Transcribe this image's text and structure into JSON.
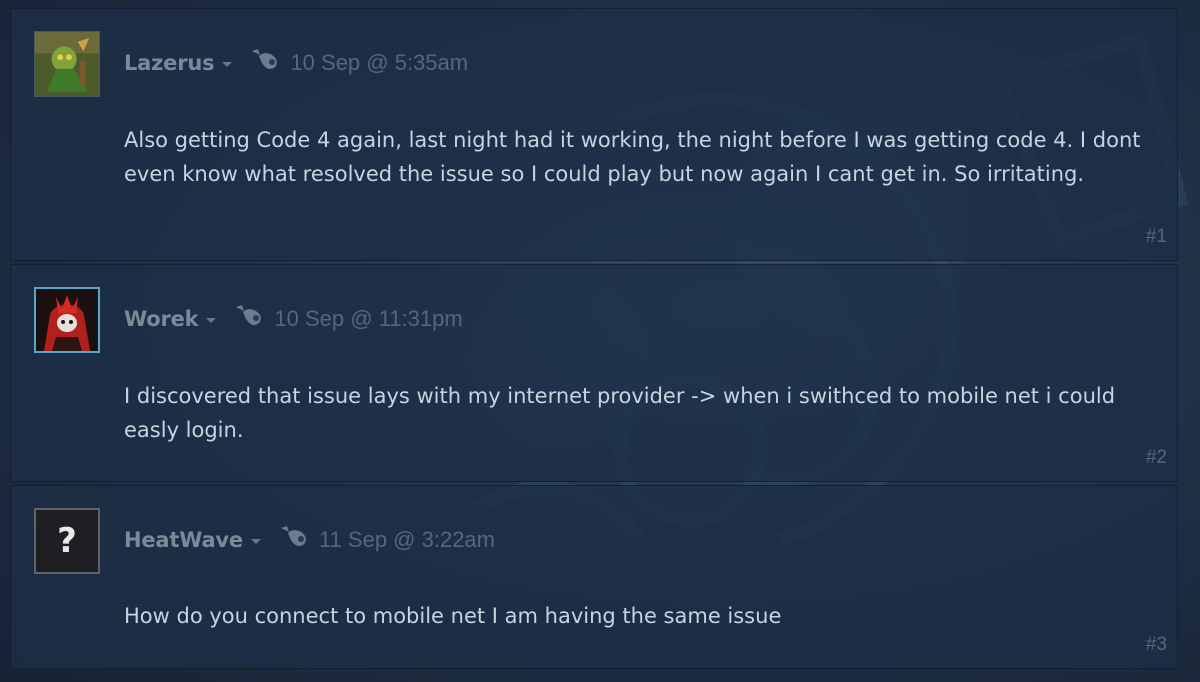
{
  "comments": [
    {
      "author": "Lazerus",
      "timestamp": "10 Sep @ 5:35am",
      "text": "Also getting Code 4 again, last night had it working, the night before I was getting code 4. I dont even know what resolved the issue so I could play but now again I cant get in. So irritating.",
      "number": "#1",
      "avatar_icon": "goblin-avatar-icon"
    },
    {
      "author": "Worek",
      "timestamp": "10 Sep @ 11:31pm",
      "text": "I discovered that issue lays with my internet provider -> when i swithced to mobile net i could easly login.",
      "number": "#2",
      "avatar_icon": "red-hood-avatar-icon"
    },
    {
      "author": "HeatWave",
      "timestamp": "11 Sep @ 3:22am",
      "text": "How do you connect to mobile net I am having the same issue",
      "number": "#3",
      "avatar_icon": "question-mark",
      "avatar_glyph": "?"
    }
  ],
  "colors": {
    "author": "#7b8a99",
    "timestamp": "#56677a",
    "text": "#c7d3df",
    "online_border": "#57a7c9"
  }
}
